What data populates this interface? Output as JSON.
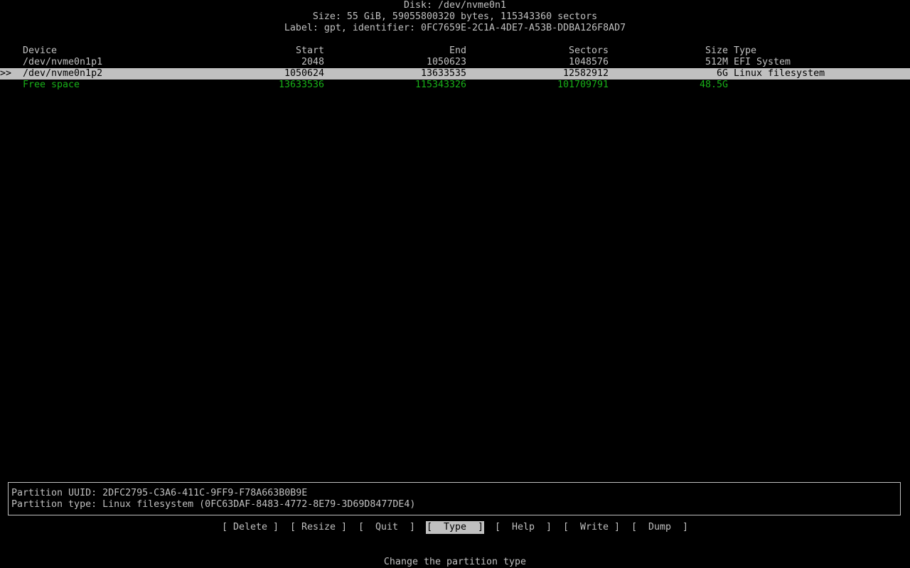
{
  "header": {
    "disk": "Disk: /dev/nvme0n1",
    "size": "Size: 55 GiB, 59055800320 bytes, 115343360 sectors",
    "label": "Label: gpt, identifier: 0FC7659E-2C1A-4DE7-A53B-DDBA126F8AD7"
  },
  "table": {
    "columns": {
      "device": "Device",
      "start": "Start",
      "end": "End",
      "sectors": "Sectors",
      "size": "Size",
      "type": "Type"
    },
    "selection_marker": ">>",
    "rows": [
      {
        "device": "/dev/nvme0n1p1",
        "start": "2048",
        "end": "1050623",
        "sectors": "1048576",
        "size": "512M",
        "type": "EFI System"
      },
      {
        "device": "/dev/nvme0n1p2",
        "start": "1050624",
        "end": "13633535",
        "sectors": "12582912",
        "size": "6G",
        "type": "Linux filesystem"
      },
      {
        "device": "Free space",
        "start": "13633536",
        "end": "115343326",
        "sectors": "101709791",
        "size": "48.5G",
        "type": ""
      }
    ]
  },
  "info": {
    "uuid": "Partition UUID: 2DFC2795-C3A6-411C-9FF9-F78A663B0B9E",
    "ptype": "Partition type: Linux filesystem (0FC63DAF-8483-4772-8E79-3D69D8477DE4)"
  },
  "menu": {
    "delete": "[ Delete ]",
    "resize": "[ Resize ]",
    "quit": "[  Quit  ]",
    "type": "[  Type  ]",
    "help": "[  Help  ]",
    "write": "[  Write ]",
    "dump": "[  Dump  ]",
    "active": "type"
  },
  "status": {
    "hint": "Change the partition type"
  },
  "colors": {
    "background": "#000000",
    "foreground": "#c0c0c0",
    "free_space": "#18b018"
  }
}
